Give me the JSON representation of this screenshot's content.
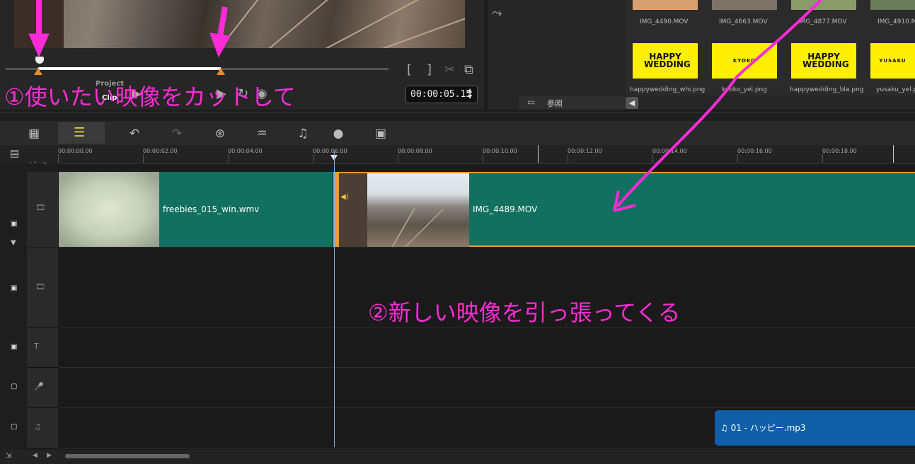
{
  "preview": {
    "project_label": "Project",
    "clip_label": "Clip",
    "timecode": "00:00:05.15",
    "mark_in_glyph": "[",
    "mark_out_glyph": "]"
  },
  "library": {
    "browse_label": "参照",
    "top_row": [
      "IMG_4490.MOV",
      "IMG_4663.MOV",
      "IMG_4877.MOV",
      "IMG_4910.M"
    ],
    "thumb_texts": [
      "HAPPY WEDDING",
      "KYOKO",
      "HAPPY WEDDING",
      "YUSAKU"
    ],
    "bottom_row": [
      "happywedding_whi.png",
      "kyoko_yel.png",
      "happywedding_bla.png",
      "yusaku_yel.p"
    ],
    "thumb_color": "#ffef00"
  },
  "ruler": {
    "labels": [
      "00:00:00.00",
      "00:00:02.00",
      "00:00:04.00",
      "00:00:06.00",
      "00:00:08.00",
      "00:00:10.00",
      "00:00:12.00",
      "00:00:14.00",
      "00:00:16.00",
      "00:00:18.00"
    ]
  },
  "tracks": {
    "add_remove": "+/− ▾",
    "video_clip_1": "freebies_015_win.wmv",
    "video_clip_2": "IMG_4489.MOV",
    "audio_clip": "♫ 01 - ハッピー.mp3"
  },
  "annotations": {
    "step1": "①使いたい映像をカットして",
    "step2": "②新しい映像を引っ張ってくる",
    "color": "#ff2bd6"
  }
}
